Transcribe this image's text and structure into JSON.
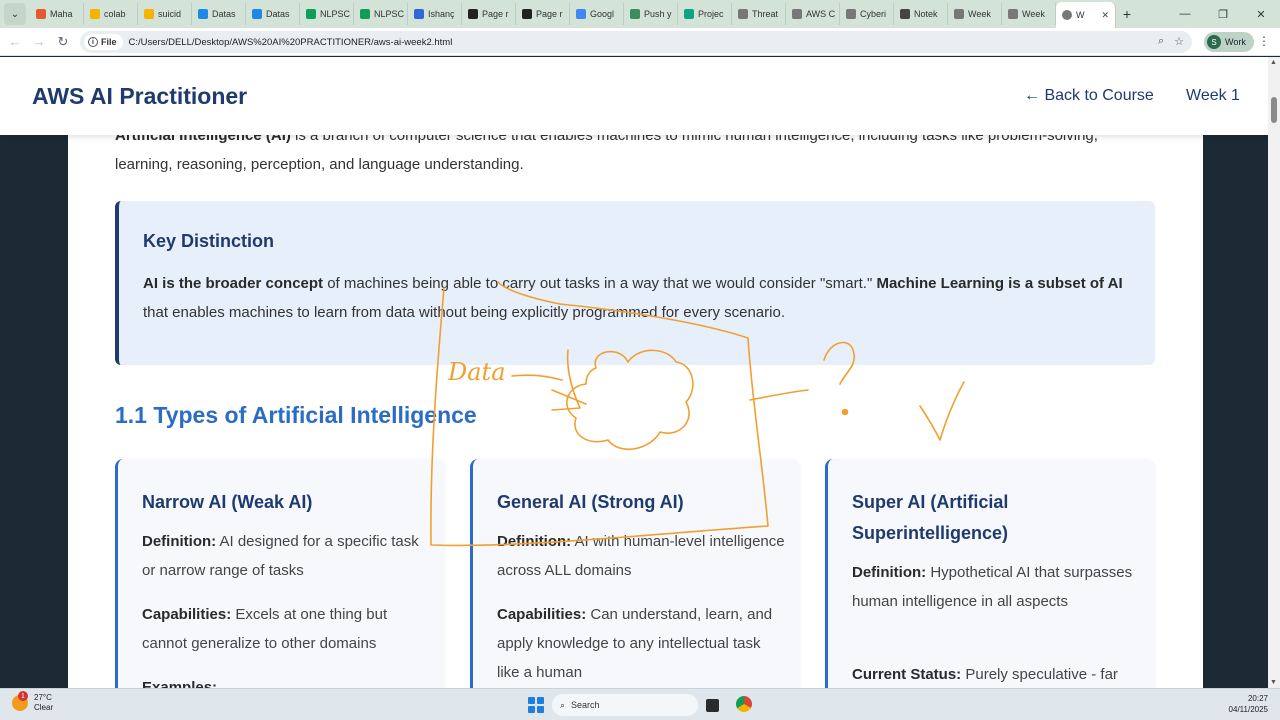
{
  "browser": {
    "tabs": [
      {
        "label": "Maha",
        "color": "#e25b2d"
      },
      {
        "label": "colab",
        "color": "#f4b400"
      },
      {
        "label": "suicid",
        "color": "#f4b400"
      },
      {
        "label": "Datas",
        "color": "#1e88e5"
      },
      {
        "label": "Datas",
        "color": "#1e88e5"
      },
      {
        "label": "NLPSC",
        "color": "#0f9d58"
      },
      {
        "label": "NLPSC",
        "color": "#0f9d58"
      },
      {
        "label": "Ishanç",
        "color": "#3367d6"
      },
      {
        "label": "Page r",
        "color": "#222222"
      },
      {
        "label": "Page r",
        "color": "#222222"
      },
      {
        "label": "Googl",
        "color": "#4285f4"
      },
      {
        "label": "Push y",
        "color": "#3a8d5c"
      },
      {
        "label": "Projec",
        "color": "#11a37f"
      },
      {
        "label": "Threat",
        "color": "#777777"
      },
      {
        "label": "AWS C",
        "color": "#777777"
      },
      {
        "label": "Cyberi",
        "color": "#777777"
      },
      {
        "label": "Notek",
        "color": "#444444"
      },
      {
        "label": "Week",
        "color": "#777777"
      },
      {
        "label": "Week",
        "color": "#777777"
      }
    ],
    "active_tab": {
      "label": "W",
      "color": "#777777"
    },
    "file_chip": "File",
    "url": "C:/Users/DELL/Desktop/AWS%20AI%20PRACTITIONER/aws-ai-week2.html",
    "profile_initial": "S",
    "profile_label": "Work"
  },
  "site": {
    "title": "AWS AI Practitioner",
    "back_link": "← Back to Course",
    "week_label": "Week 1"
  },
  "intro": {
    "bold": "Artificial Intelligence (AI)",
    "rest": " is a branch of computer science that enables machines to mimic human intelligence, including tasks like problem-solving, learning, reasoning, perception, and language understanding."
  },
  "callout": {
    "heading": "Key Distinction",
    "bold1": "AI is the broader concept",
    "text1": " of machines being able to carry out tasks in a way that we would consider \"smart.\" ",
    "bold2": "Machine Learning is a subset of AI",
    "text2": " that enables machines to learn from data without being explicitly programmed for every scenario."
  },
  "section_heading": "1.1 Types of Artificial Intelligence",
  "cards": [
    {
      "title": "Narrow AI (Weak AI)",
      "def_label": "Definition:",
      "def_text": " AI designed for a specific task or narrow range of tasks",
      "second_label": "Capabilities:",
      "second_text": " Excels at one thing but cannot generalize to other domains",
      "third_label": "Examples:"
    },
    {
      "title": "General AI (Strong AI)",
      "def_label": "Definition:",
      "def_text": " AI with human-level intelligence across ALL domains",
      "second_label": "Capabilities:",
      "second_text": " Can understand, learn, and apply knowledge to any intellectual task like a human"
    },
    {
      "title": "Super AI (Artificial Superintelligence)",
      "def_label": "Definition:",
      "def_text": " Hypothetical AI that surpasses human intelligence in all aspects",
      "second_label": "Current Status:",
      "second_text": " Purely speculative - far"
    }
  ],
  "annotation": {
    "word": "Data",
    "symbol": "?",
    "color": "#f0a030"
  },
  "taskbar": {
    "badge": "1",
    "temp": "27°C",
    "condition": "Clear",
    "search_placeholder": "Search",
    "time": "20:27",
    "date": "04/11/2025"
  }
}
